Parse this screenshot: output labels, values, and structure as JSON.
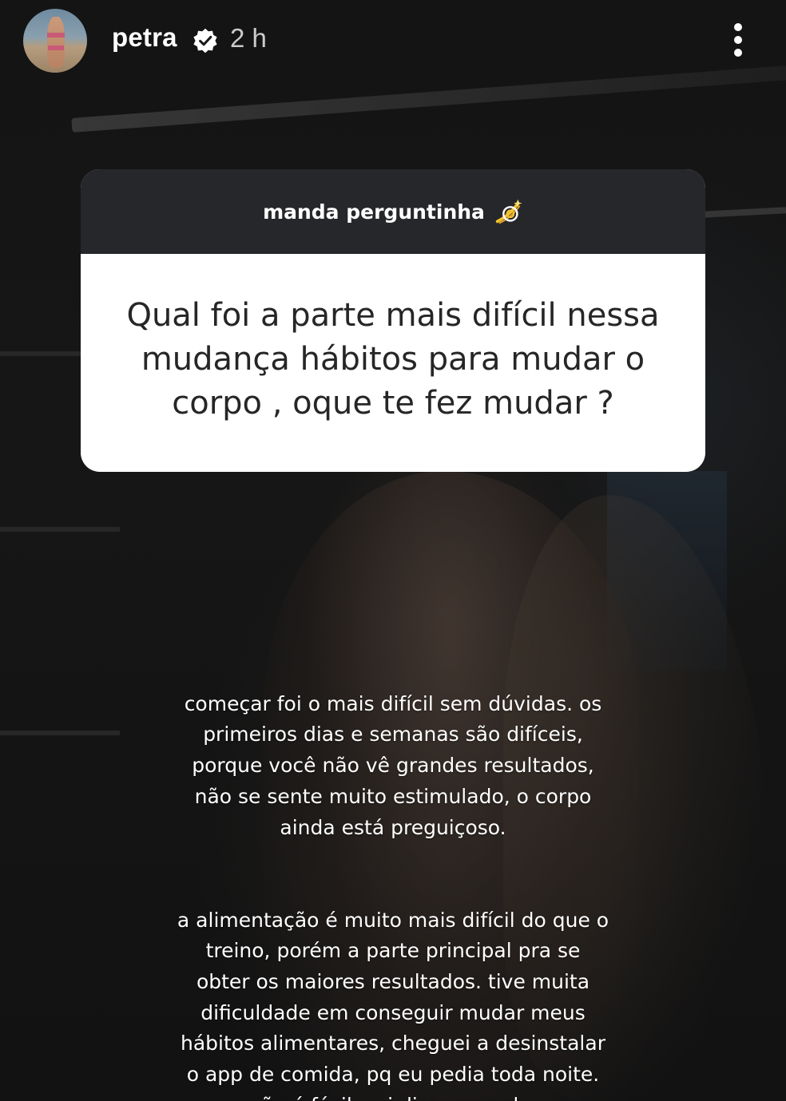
{
  "header": {
    "username": "petra",
    "verified_icon": "verified-badge-icon",
    "timestamp": "2 h",
    "more_icon": "more-vertical-icon"
  },
  "question_sticker": {
    "prompt": "manda perguntinha",
    "prompt_icon": "dizzy-emoji-icon",
    "question": "Qual foi a parte mais difícil  nessa\nmudança hábitos  para mudar o\ncorpo , oque te fez mudar ?"
  },
  "answer": {
    "paragraph_1": "começar foi o mais difícil sem dúvidas. os\nprimeiros dias e semanas são difíceis,\nporque você não vê grandes resultados,\nnão se sente muito estimulado, o corpo\nainda está preguiçoso.",
    "paragraph_2": "a alimentação é muito mais difícil do que o\ntreino, porém a parte principal pra se\nobter os maiores resultados. tive muita\ndificuldade em conseguir mudar meus\nhábitos alimentares, cheguei a desinstalar\no app de comida, pq eu pedia toda noite.\nnão é fácil, sei disso na pele."
  },
  "colors": {
    "sticker_header": "#26272a",
    "sticker_body": "#ffffff",
    "question_text": "#262626",
    "overlay_text": "#ffffff"
  }
}
